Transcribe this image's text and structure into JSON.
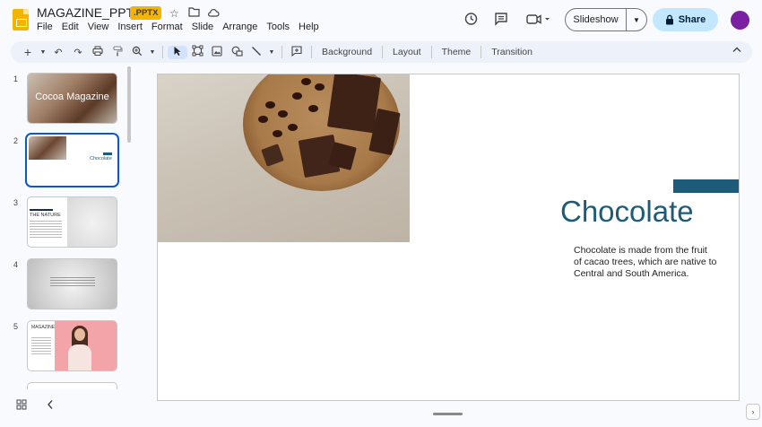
{
  "header": {
    "doc_title": "MAGAZINE_PPTX",
    "badge": ".PPTX",
    "menu": [
      "File",
      "Edit",
      "View",
      "Insert",
      "Format",
      "Slide",
      "Arrange",
      "Tools",
      "Help"
    ],
    "slideshow_label": "Slideshow",
    "share_label": "Share"
  },
  "toolbar": {
    "background": "Background",
    "layout": "Layout",
    "theme": "Theme",
    "transition": "Transition"
  },
  "filmstrip": {
    "slides": [
      {
        "number": "1",
        "title": "Cocoa Magazine"
      },
      {
        "number": "2",
        "title": "Chocolate"
      },
      {
        "number": "3",
        "title": "THE NATURE"
      },
      {
        "number": "4",
        "title": ""
      },
      {
        "number": "5",
        "title": "MAGAZINE"
      }
    ]
  },
  "slide": {
    "title": "Chocolate",
    "body": "Chocolate is made from the fruit of cacao trees, which are native to Central and South America."
  },
  "colors": {
    "accent": "#1d5b79",
    "share_bg": "#c2e7ff",
    "badge": "#f4b400",
    "avatar": "#7b1fa2",
    "selected": "#0b57d0"
  }
}
